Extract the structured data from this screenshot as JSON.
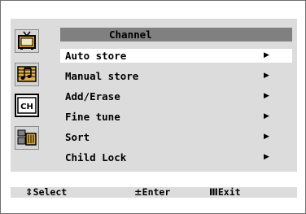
{
  "menu": {
    "title": "Channel",
    "items": [
      {
        "label": "Auto store",
        "arrow": "▶",
        "selected": true
      },
      {
        "label": "Manual store",
        "arrow": "▶"
      },
      {
        "label": "Add/Erase",
        "arrow": "▶"
      },
      {
        "label": "Fine tune",
        "arrow": "▶"
      },
      {
        "label": "Sort",
        "arrow": "▶"
      },
      {
        "label": "Child Lock",
        "arrow": "▶"
      }
    ]
  },
  "sidebar": {
    "icons": [
      {
        "name": "tv-picture-icon"
      },
      {
        "name": "music-sound-icon"
      },
      {
        "name": "channel-icon",
        "text": "CH",
        "active": true
      },
      {
        "name": "setup-icon"
      }
    ]
  },
  "status": {
    "select_symbol": "⇕",
    "select_label": "Select",
    "enter_symbol": "±",
    "enter_label": "Enter",
    "exit_symbol": "Ⅲ",
    "exit_label": "Exit"
  },
  "colors": {
    "frame": "#dcdcdc",
    "title_bar": "#808080",
    "selected_row": "#ffffff"
  }
}
